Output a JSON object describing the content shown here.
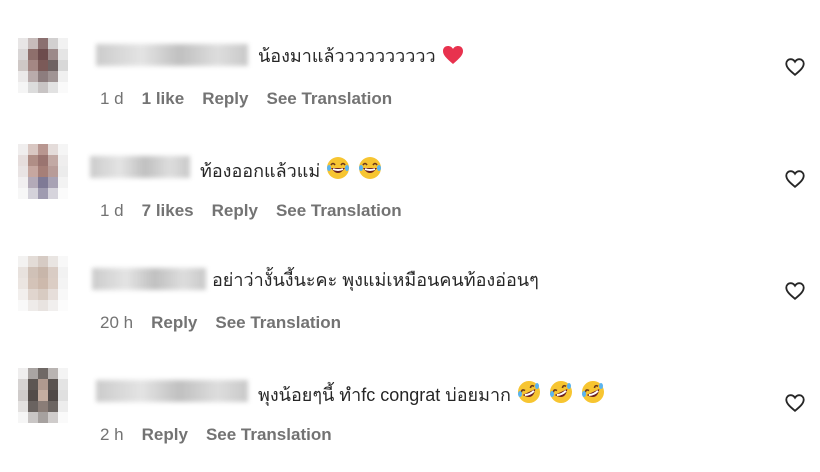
{
  "comments": [
    {
      "text": "น้องมาแล้วววววววววว",
      "time": "1 d",
      "likes": "1 like",
      "reply_label": "Reply",
      "translate_label": "See Translation",
      "emoji": [
        "red-heart"
      ]
    },
    {
      "text": "ท้องออกแล้วแม่",
      "time": "1 d",
      "likes": "7 likes",
      "reply_label": "Reply",
      "translate_label": "See Translation",
      "emoji": [
        "laughing-face",
        "laughing-face"
      ]
    },
    {
      "text": "อย่าว่างั้นงี้นะคะ พุงแม่เหมือนคนท้องอ่อนๆ",
      "time": "20 h",
      "likes": "",
      "reply_label": "Reply",
      "translate_label": "See Translation",
      "emoji": []
    },
    {
      "text": "พุงน้อยๆนี้ ทำfc congrat บ่อยมาก",
      "time": "2 h",
      "likes": "",
      "reply_label": "Reply",
      "translate_label": "See Translation",
      "emoji": [
        "rolling-laughing-face",
        "rolling-laughing-face",
        "rolling-laughing-face"
      ]
    }
  ],
  "colors": {
    "text": "#262626",
    "meta": "#737373",
    "heart_outline": "#262626",
    "emoji_heart": "#e8324e"
  }
}
